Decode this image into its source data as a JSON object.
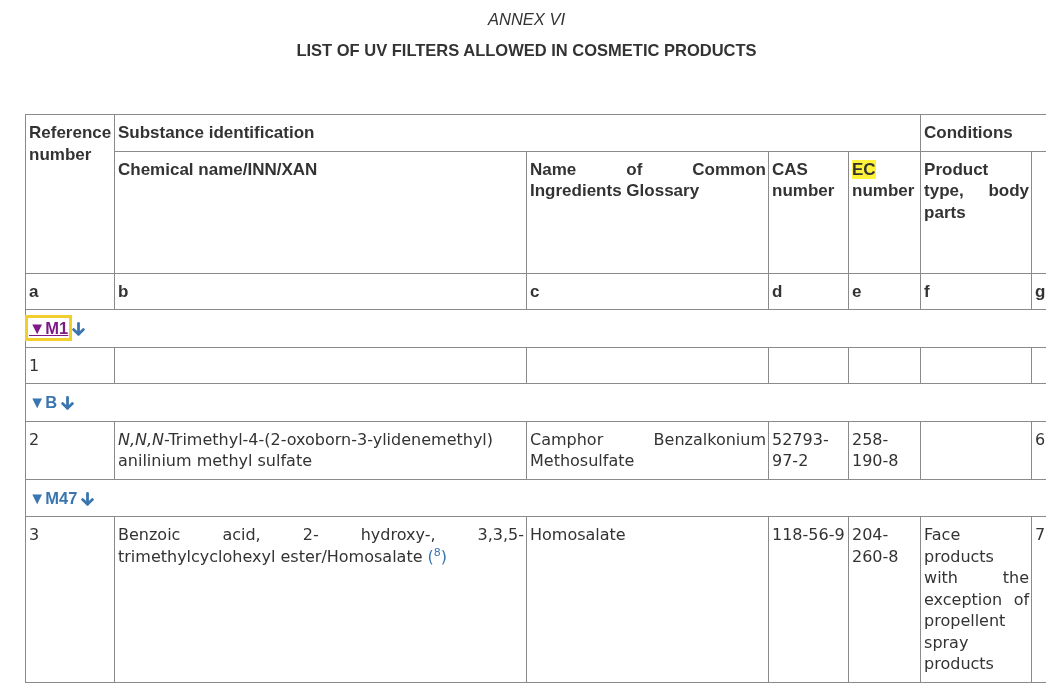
{
  "annex": "ANNEX VI",
  "title": "LIST OF UV FILTERS ALLOWED IN COSMETIC PRODUCTS",
  "table": {
    "header_top": [
      "Reference number",
      "Substance identification",
      "Conditions"
    ],
    "columns": [
      {
        "parts": [
          {
            "text": "Chemical name/INN/XAN",
            "highlighted": false
          }
        ]
      },
      {
        "parts": [
          {
            "text": "Name of Common Ingredients Glossary",
            "highlighted": false
          }
        ]
      },
      {
        "parts": [
          {
            "text": "CAS number",
            "highlighted": false
          }
        ]
      },
      {
        "parts": [
          {
            "text": "EC",
            "highlighted": true
          },
          {
            "text": "number",
            "highlighted": false
          }
        ]
      },
      {
        "parts": [
          {
            "text": "Product type, body parts",
            "highlighted": false
          }
        ]
      }
    ],
    "column_letters": [
      "a",
      "b",
      "c",
      "d",
      "e",
      "f",
      "g"
    ],
    "sections": [
      {
        "marker": "▼M1",
        "visited": true,
        "focused": true,
        "rows": [
          {
            "reference": "1"
          }
        ]
      },
      {
        "marker": "▼B",
        "visited": false,
        "focused": false,
        "rows": [
          {
            "reference": "2",
            "chemical_name": "*N,N,N*-Trimethyl-4-(2-oxoborn-3-ylidenemethyl) anilinium methyl sulfate",
            "glossary_name": "Camphor Benzalkonium Methosulfate",
            "cas_number": "52793-97-2",
            "ec_number": "258-190-8",
            "column_g": "6"
          }
        ]
      },
      {
        "marker": "▼M47",
        "visited": false,
        "focused": false,
        "rows": [
          {
            "reference": "3",
            "chemical_name": "Benzoic acid, 2- hydroxy-, 3,3,5-trimethylcyclohexyl ester/Homosalate",
            "chemical_name_footnote": "($^{8}$)",
            "glossary_name": "Homosalate",
            "cas_number": "118-56-9",
            "ec_number": "204-260-8",
            "product_type": "Face products with the exception of propellent spray products",
            "column_g": "7"
          }
        ]
      }
    ]
  }
}
